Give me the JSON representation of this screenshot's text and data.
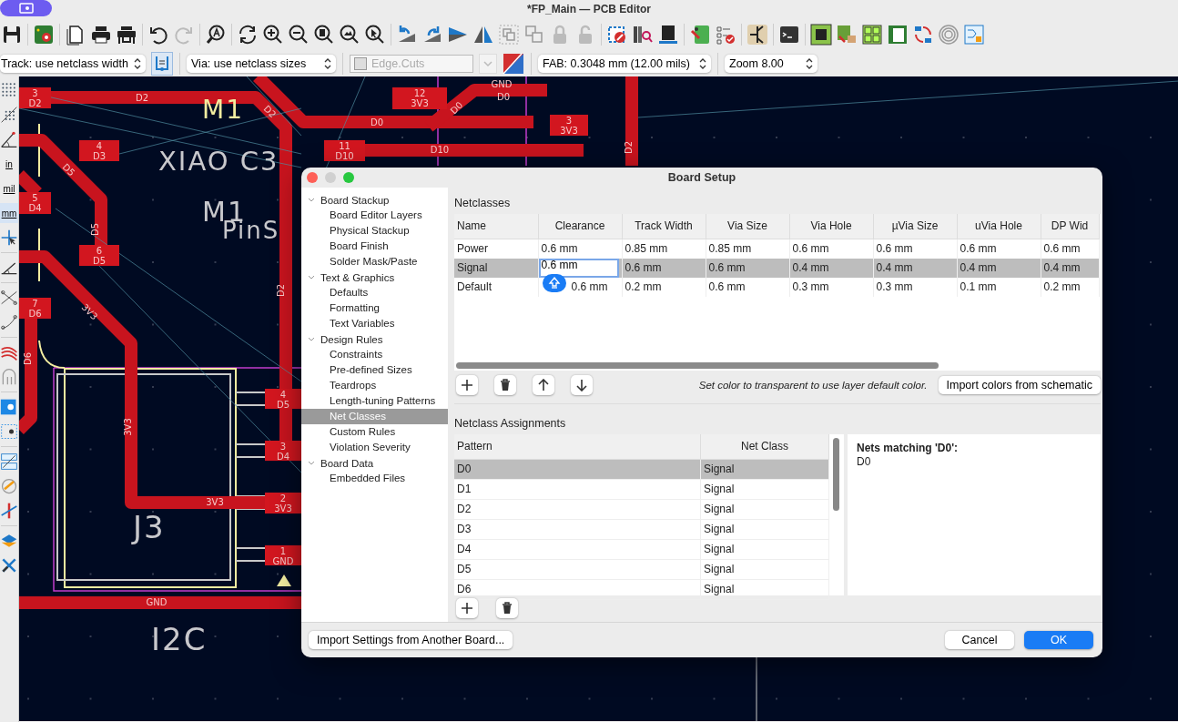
{
  "window": {
    "title": "*FP_Main — PCB Editor"
  },
  "options_bar": {
    "track": "Track: use netclass width",
    "via": "Via: use netclass sizes",
    "layer": {
      "value": "Edge.Cuts",
      "disabled": true
    },
    "grid": "FAB: 0.3048 mm (12.00 mils)",
    "zoom": "Zoom 8.00"
  },
  "left_toolbar": {
    "units": [
      {
        "label": "in",
        "selected": false
      },
      {
        "label": "mil",
        "selected": false
      },
      {
        "label": "mm",
        "selected": true
      }
    ]
  },
  "canvas": {
    "pads": [
      {
        "number": "3",
        "net": "D2"
      },
      {
        "number": "4",
        "net": "D3"
      },
      {
        "number": "5",
        "net": "D4"
      },
      {
        "number": "6",
        "net": "D5"
      },
      {
        "number": "7",
        "net": "D6"
      },
      {
        "number": "12",
        "net": "3V3"
      },
      {
        "number": "11",
        "net": "D10"
      },
      {
        "number": "3",
        "net": "3V3"
      },
      {
        "number": "4",
        "net": "D5"
      },
      {
        "number": "3",
        "net": "D4"
      },
      {
        "number": "2",
        "net": "3V3"
      },
      {
        "number": "1",
        "net": "GND"
      }
    ],
    "track_labels": [
      "D2",
      "D2",
      "D5",
      "D5",
      "3V3",
      "D6",
      "D2",
      "3V3",
      "3V3",
      "GND",
      "D0",
      "D0",
      "D0",
      "D10",
      "D2",
      "GND"
    ],
    "silkscreen": [
      "M1",
      "XIAO C3",
      "M1",
      "PinS",
      "J3",
      "I2C"
    ]
  },
  "dialog": {
    "title": "Board Setup",
    "tree": [
      {
        "label": "Board Stackup",
        "expanded": true,
        "children": [
          {
            "label": "Board Editor Layers",
            "selected": false
          },
          {
            "label": "Physical Stackup",
            "selected": false
          },
          {
            "label": "Board Finish",
            "selected": false
          },
          {
            "label": "Solder Mask/Paste",
            "selected": false
          }
        ]
      },
      {
        "label": "Text & Graphics",
        "expanded": true,
        "children": [
          {
            "label": "Defaults",
            "selected": false
          },
          {
            "label": "Formatting",
            "selected": false
          },
          {
            "label": "Text Variables",
            "selected": false
          }
        ]
      },
      {
        "label": "Design Rules",
        "expanded": true,
        "children": [
          {
            "label": "Constraints",
            "selected": false
          },
          {
            "label": "Pre-defined Sizes",
            "selected": false
          },
          {
            "label": "Teardrops",
            "selected": false
          },
          {
            "label": "Length-tuning Patterns",
            "selected": false
          },
          {
            "label": "Net Classes",
            "selected": true
          },
          {
            "label": "Custom Rules",
            "selected": false
          },
          {
            "label": "Violation Severity",
            "selected": false
          }
        ]
      },
      {
        "label": "Board Data",
        "expanded": true,
        "children": [
          {
            "label": "Embedded Files",
            "selected": false
          }
        ]
      }
    ],
    "netclasses": {
      "title": "Netclasses",
      "columns": [
        "Name",
        "Clearance",
        "Track Width",
        "Via Size",
        "Via Hole",
        "µVia Size",
        "uVia Hole",
        "DP Wid"
      ],
      "rows": [
        {
          "cells": [
            "Power",
            "0.6 mm",
            "0.85 mm",
            "0.85 mm",
            "0.6 mm",
            "0.6 mm",
            "0.6 mm",
            "0.6 mm"
          ],
          "selected": false,
          "editing": false
        },
        {
          "cells": [
            "Signal",
            "0.6 mm",
            "0.6 mm",
            "0.6 mm",
            "0.4 mm",
            "0.4 mm",
            "0.4 mm",
            "0.4 mm"
          ],
          "selected": true,
          "editing": true
        },
        {
          "cells": [
            "Default",
            "0.6 mm",
            "0.2 mm",
            "0.6 mm",
            "0.3 mm",
            "0.3 mm",
            "0.1 mm",
            "0.2 mm"
          ],
          "selected": false,
          "editing": false
        }
      ],
      "note": "Set color to transparent to use layer default color.",
      "import_button": "Import colors from schematic"
    },
    "assignments": {
      "title": "Netclass Assignments",
      "columns": [
        "Pattern",
        "Net Class"
      ],
      "rows": [
        {
          "pattern": "D0",
          "netclass": "Signal",
          "selected": true
        },
        {
          "pattern": "D1",
          "netclass": "Signal",
          "selected": false
        },
        {
          "pattern": "D2",
          "netclass": "Signal",
          "selected": false
        },
        {
          "pattern": "D3",
          "netclass": "Signal",
          "selected": false
        },
        {
          "pattern": "D4",
          "netclass": "Signal",
          "selected": false
        },
        {
          "pattern": "D5",
          "netclass": "Signal",
          "selected": false
        },
        {
          "pattern": "D6",
          "netclass": "Signal",
          "selected": false
        }
      ],
      "matching_title": "Nets matching 'D0':",
      "matching": [
        "D0"
      ]
    },
    "footer": {
      "import_settings": "Import Settings from Another Board...",
      "cancel": "Cancel",
      "ok": "OK"
    }
  }
}
